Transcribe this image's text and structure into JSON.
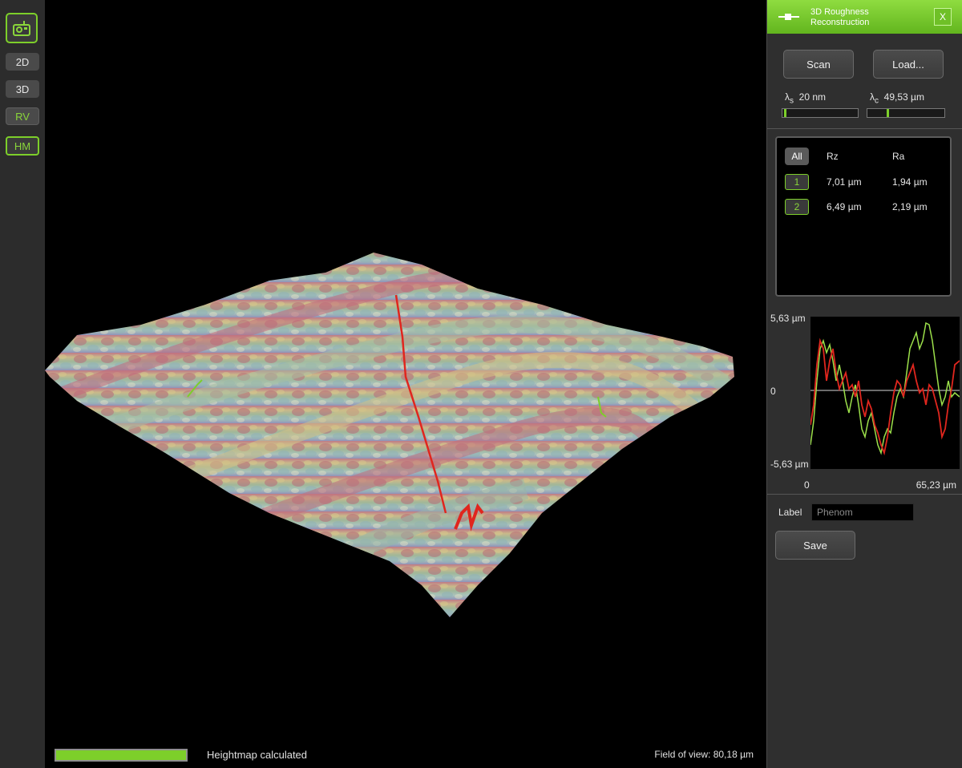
{
  "sidebar": {
    "buttons": [
      {
        "label": "2D"
      },
      {
        "label": "3D"
      },
      {
        "label": "RV"
      },
      {
        "label": "HM"
      }
    ]
  },
  "panel": {
    "title_line1": "3D Roughness",
    "title_line2": "Reconstruction",
    "close_label": "X",
    "scan_label": "Scan",
    "load_label": "Load...",
    "lambda_s_symbol": "λ",
    "lambda_s_sub": "s",
    "lambda_s_value": "20 nm",
    "lambda_s_level": 0.02,
    "lambda_c_symbol": "λ",
    "lambda_c_sub": "c",
    "lambda_c_value": "49,53 µm",
    "lambda_c_level": 0.25,
    "table": {
      "all_label": "All",
      "headers": [
        "Rz",
        "Ra"
      ],
      "rows": [
        {
          "id": "1",
          "rz": "7,01 µm",
          "ra": "1,94 µm"
        },
        {
          "id": "2",
          "rz": "6,49 µm",
          "ra": "2,19 µm"
        }
      ]
    },
    "label_caption": "Label",
    "label_value": "Phenom",
    "save_label": "Save"
  },
  "profile_plot": {
    "y_top": "5,63 µm",
    "y_zero": "0",
    "y_bottom": "-5,63 µm",
    "x_start": "0",
    "x_end": "65,23 µm",
    "colors": {
      "profile_1": "#9ce04a",
      "profile_2": "#e0261e"
    }
  },
  "status": {
    "progress": 1.0,
    "message": "Heightmap calculated",
    "field_of_view": "Field of view: 80,18 µm"
  },
  "colors": {
    "accent": "#7dcf2a",
    "panel_bg": "#2f2f2f"
  }
}
